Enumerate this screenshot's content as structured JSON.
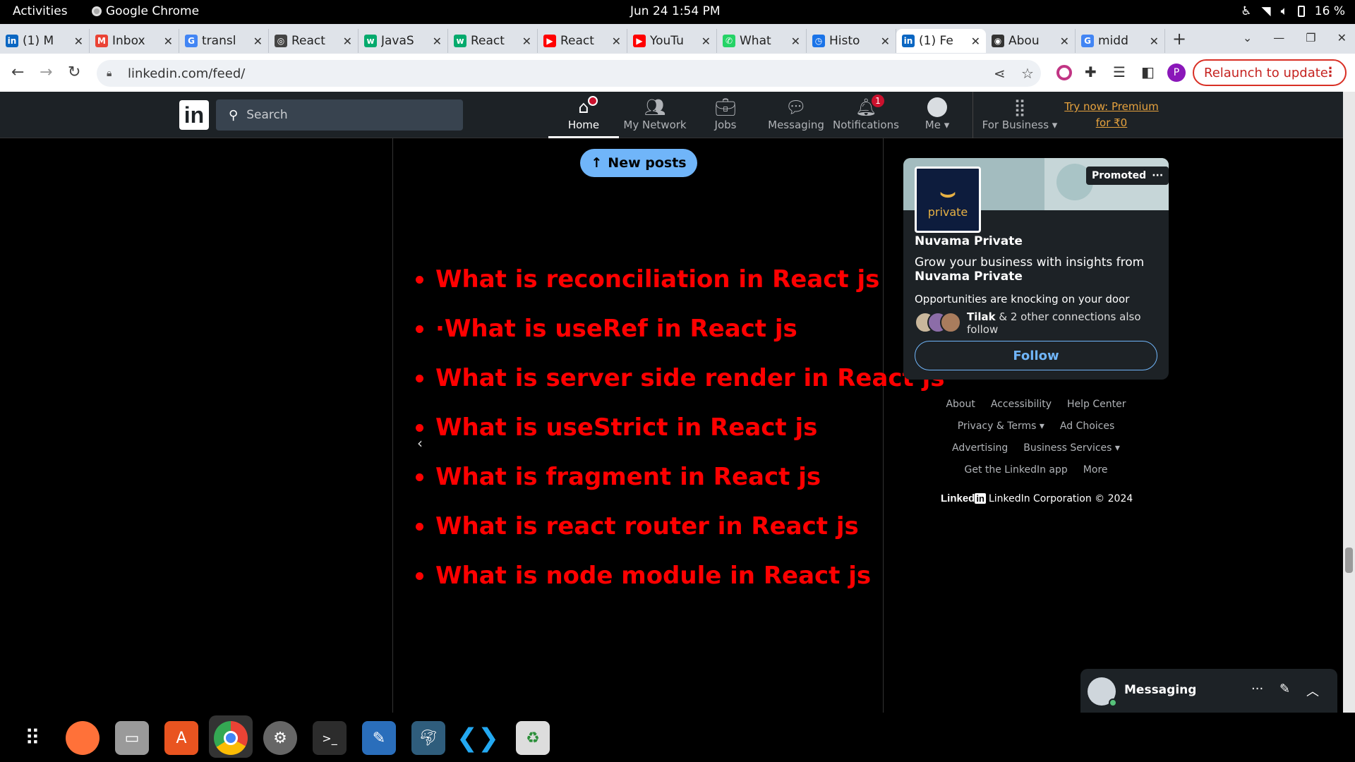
{
  "system": {
    "activities": "Activities",
    "app_name": "Google Chrome",
    "clock": "Jun 24  1:54 PM",
    "battery": "16 %"
  },
  "tabs": [
    {
      "title": "(1) M",
      "color": "#0a66c2",
      "glyph": "in"
    },
    {
      "title": "Inbox",
      "color": "#ea4335",
      "glyph": "M"
    },
    {
      "title": "transl",
      "color": "#4285f4",
      "glyph": "G"
    },
    {
      "title": "React",
      "color": "#444444",
      "glyph": "◎"
    },
    {
      "title": "JavaS",
      "color": "#04aa6d",
      "glyph": "w"
    },
    {
      "title": "React",
      "color": "#04aa6d",
      "glyph": "w"
    },
    {
      "title": "React",
      "color": "#ff0000",
      "glyph": "▶"
    },
    {
      "title": "YouTu",
      "color": "#ff0000",
      "glyph": "▶"
    },
    {
      "title": "What",
      "color": "#25d366",
      "glyph": "✆"
    },
    {
      "title": "Histo",
      "color": "#1a73e8",
      "glyph": "◷"
    },
    {
      "title": "(1) Fe",
      "color": "#0a66c2",
      "glyph": "in",
      "active": true
    },
    {
      "title": "Abou",
      "color": "#333333",
      "glyph": "◉"
    },
    {
      "title": "midd",
      "color": "#4285f4",
      "glyph": "G"
    }
  ],
  "browser": {
    "url": "linkedin.com/feed/",
    "profile_initial": "P",
    "relaunch_label": "Relaunch to update"
  },
  "linkedin": {
    "logo": "in",
    "search_placeholder": "Search",
    "nav": {
      "home": "Home",
      "network": "My Network",
      "jobs": "Jobs",
      "messaging": "Messaging",
      "notifications": "Notifications",
      "notifications_count": "1",
      "me": "Me",
      "business": "For Business"
    },
    "premium_line1": "Try now: Premium",
    "premium_line2": "for ₹0"
  },
  "feed": {
    "new_posts_label": "New posts",
    "questions": [
      "What is reconciliation in React js",
      "·What is useRef in React js",
      "What is server side render in React js",
      " What is useStrict in React js",
      "What is fragment in React js",
      "What is react router in React js",
      "What is node module in React js"
    ],
    "bullet_color": "#ff0000"
  },
  "ad": {
    "logo_text": "private",
    "promoted": "Promoted",
    "company": "Nuvama Private",
    "headline": "Grow your business with insights from",
    "headline_bold": "Nuvama Private",
    "subline": "Opportunities are knocking on your door",
    "connection_name": "Tilak",
    "connection_text": "& 2 other connections also follow",
    "follow_label": "Follow"
  },
  "footer": {
    "about": "About",
    "accessibility": "Accessibility",
    "help_center": "Help Center",
    "privacy_terms": "Privacy & Terms",
    "ad_choices": "Ad Choices",
    "advertising": "Advertising",
    "business_services": "Business Services",
    "get_app": "Get the LinkedIn app",
    "more": "More",
    "brand": "Linked",
    "brand_in": "in",
    "corporation": "LinkedIn Corporation © 2024"
  },
  "messaging": {
    "label": "Messaging"
  }
}
